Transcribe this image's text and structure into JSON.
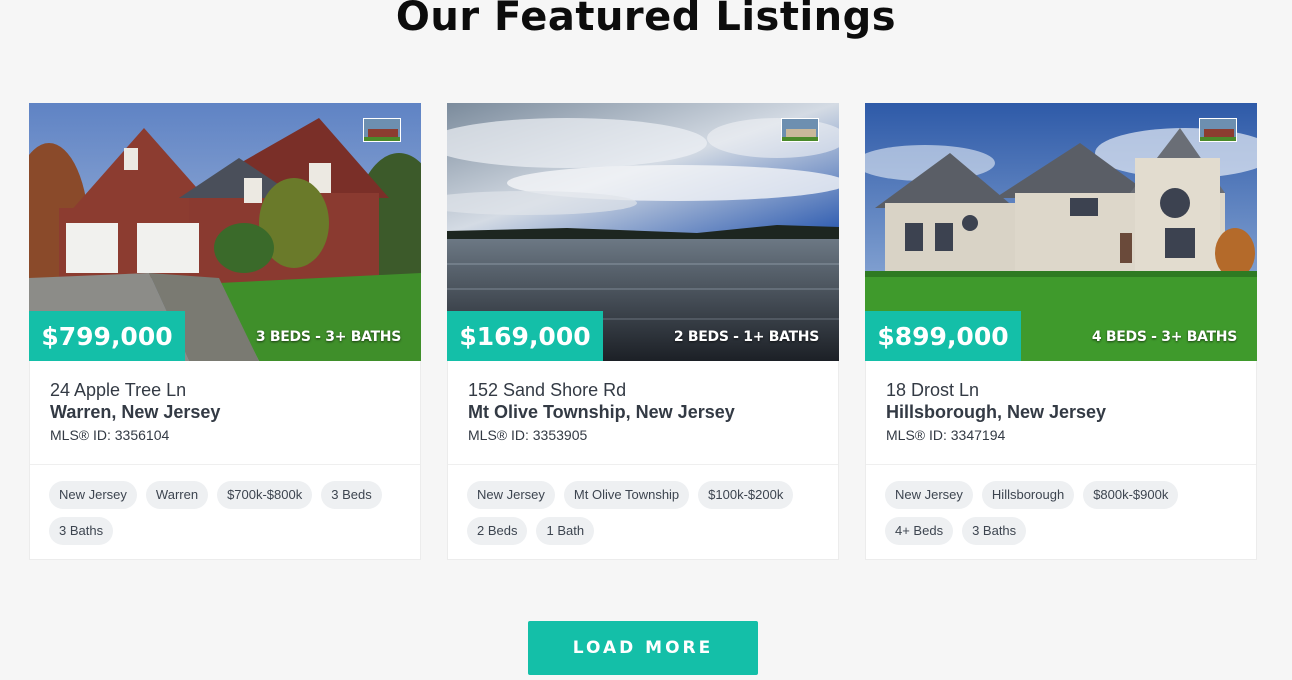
{
  "header": {
    "title": "Our Featured Listings"
  },
  "listings": [
    {
      "price": "$799,000",
      "beds_baths": "3 BEDS - 3+ BATHS",
      "street": "24 Apple Tree Ln",
      "city": "Warren, New Jersey",
      "mls": "MLS® ID: 3356104",
      "tags": [
        "New Jersey",
        "Warren",
        "$700k-$800k",
        "3 Beds",
        "3 Baths"
      ]
    },
    {
      "price": "$169,000",
      "beds_baths": "2 BEDS - 1+ BATHS",
      "street": "152 Sand Shore Rd",
      "city": "Mt Olive Township, New Jersey",
      "mls": "MLS® ID: 3353905",
      "tags": [
        "New Jersey",
        "Mt Olive Township",
        "$100k-$200k",
        "2 Beds",
        "1 Bath"
      ]
    },
    {
      "price": "$899,000",
      "beds_baths": "4 BEDS - 3+ BATHS",
      "street": "18 Drost Ln",
      "city": "Hillsborough, New Jersey",
      "mls": "MLS® ID: 3347194",
      "tags": [
        "New Jersey",
        "Hillsborough",
        "$800k-$900k",
        "4+ Beds",
        "3 Baths"
      ]
    }
  ],
  "actions": {
    "load_more_label": "LOAD MORE"
  },
  "colors": {
    "accent": "#14bfa8",
    "background": "#f6f6f6",
    "text": "#333a44",
    "tag_bg": "#eef0f2"
  }
}
